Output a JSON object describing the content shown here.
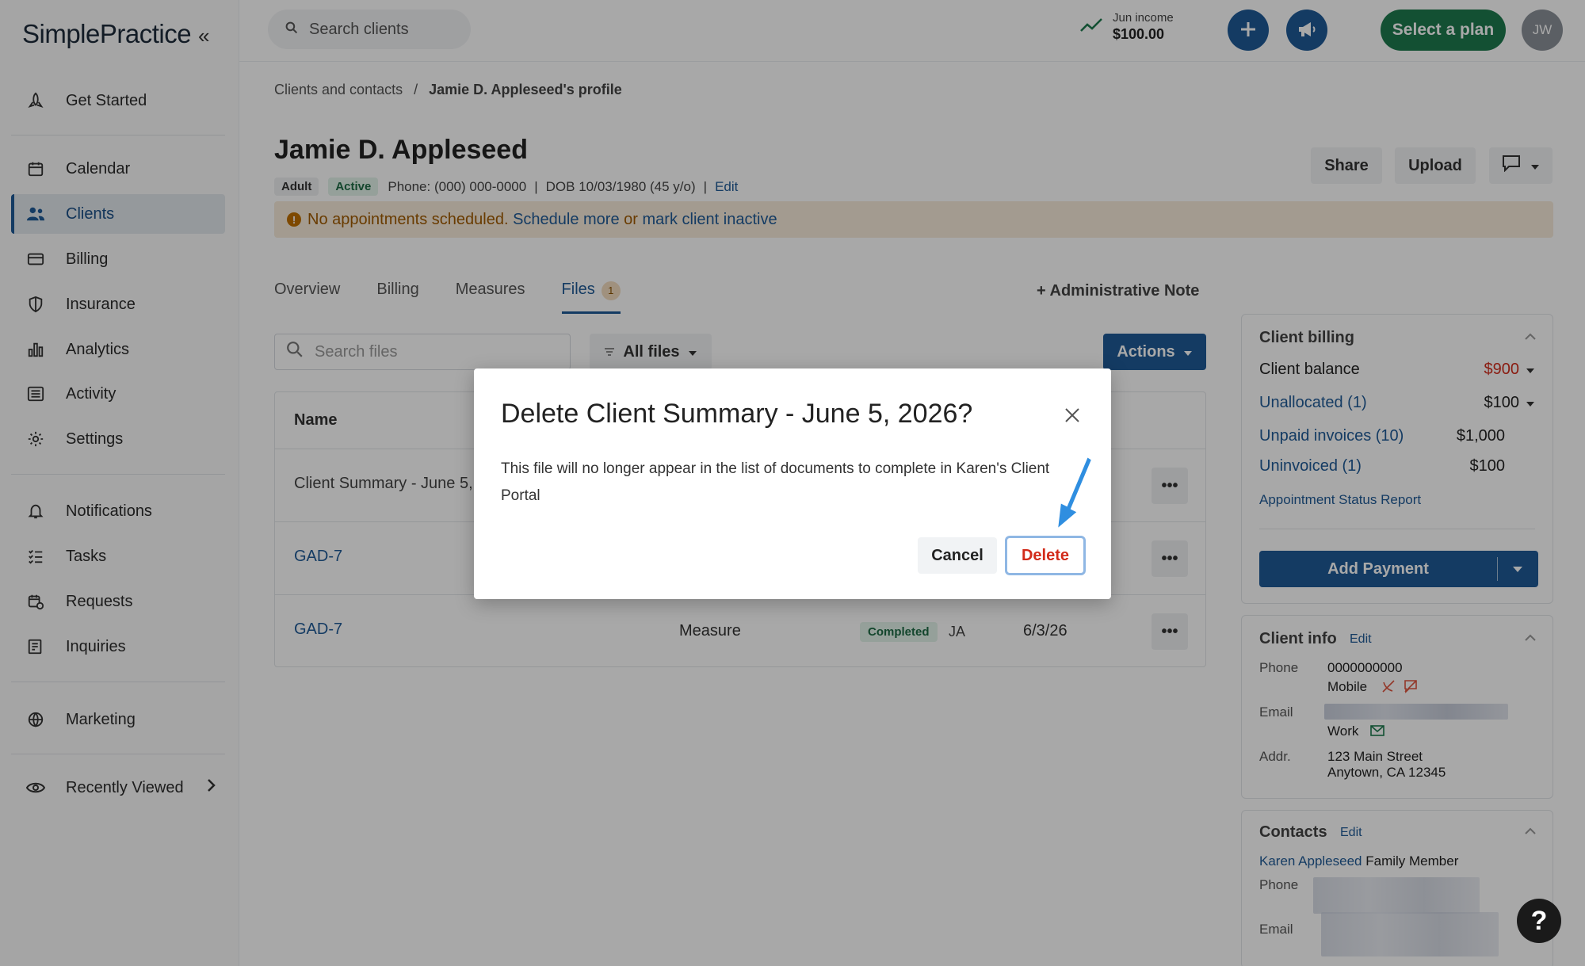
{
  "app": {
    "logo": "SimplePractice",
    "collapse_glyph": "«"
  },
  "sidebar": {
    "items": [
      {
        "label": "Get Started",
        "icon": "rocket-icon"
      },
      {
        "label": "Calendar",
        "icon": "calendar-icon"
      },
      {
        "label": "Clients",
        "icon": "users-icon",
        "active": true
      },
      {
        "label": "Billing",
        "icon": "credit-card-icon"
      },
      {
        "label": "Insurance",
        "icon": "shield-icon"
      },
      {
        "label": "Analytics",
        "icon": "bar-chart-icon"
      },
      {
        "label": "Activity",
        "icon": "list-icon"
      },
      {
        "label": "Settings",
        "icon": "gear-icon"
      },
      {
        "label": "Notifications",
        "icon": "bell-icon"
      },
      {
        "label": "Tasks",
        "icon": "checklist-icon"
      },
      {
        "label": "Requests",
        "icon": "calendar-clock-icon"
      },
      {
        "label": "Inquiries",
        "icon": "inbox-icon"
      },
      {
        "label": "Marketing",
        "icon": "globe-icon"
      },
      {
        "label": "Recently Viewed",
        "icon": "eye-icon"
      }
    ]
  },
  "topbar": {
    "search_placeholder": "Search clients",
    "income_label": "Jun income",
    "income_value": "$100.00",
    "plan_button": "Select a plan",
    "avatar_initials": "JW"
  },
  "breadcrumb": {
    "parent": "Clients and contacts",
    "separator": "/",
    "current": "Jamie D. Appleseed's profile"
  },
  "client": {
    "name": "Jamie D. Appleseed",
    "tag_age": "Adult",
    "tag_status": "Active",
    "phone": "Phone: (000) 000-0000",
    "dob": "DOB 10/03/1980 (45 y/o)",
    "edit": "Edit",
    "pipe": "|"
  },
  "alert": {
    "icon": "!",
    "text": "No appointments scheduled.",
    "link1": "Schedule more",
    "or": "or",
    "link2": "mark client inactive"
  },
  "header_buttons": {
    "share": "Share",
    "upload": "Upload"
  },
  "tabs": [
    {
      "label": "Overview"
    },
    {
      "label": "Billing"
    },
    {
      "label": "Measures"
    },
    {
      "label": "Files",
      "badge": "1",
      "active": true
    }
  ],
  "admin_note": "+ Administrative Note",
  "files": {
    "search_placeholder": "Search files",
    "filter_label": "All files",
    "actions_label": "Actions",
    "column_name": "Name",
    "rows": [
      {
        "name": "Client Summary - June 5,",
        "type": "",
        "status": "",
        "initials": "",
        "date": ""
      },
      {
        "name": "GAD-7",
        "type": "",
        "status": "",
        "initials": "",
        "date": ""
      },
      {
        "name": "GAD-7",
        "type": "Measure",
        "status": "Completed",
        "initials": "JA",
        "date": "6/3/26"
      }
    ],
    "more_glyph": "•••"
  },
  "billing_panel": {
    "title": "Client billing",
    "balance_label": "Client balance",
    "balance_value": "$900",
    "unallocated_label": "Unallocated (1)",
    "unallocated_value": "$100",
    "unpaid_label": "Unpaid invoices (10)",
    "unpaid_value": "$1,000",
    "uninvoiced_label": "Uninvoiced (1)",
    "uninvoiced_value": "$100",
    "report_link": "Appointment Status Report",
    "add_payment": "Add Payment"
  },
  "info_panel": {
    "title": "Client info",
    "edit": "Edit",
    "phone_label": "Phone",
    "phone_value": "0000000000",
    "phone_type": "Mobile",
    "email_label": "Email",
    "email_type": "Work",
    "addr_label": "Addr.",
    "addr_line1": "123 Main Street",
    "addr_line2": "Anytown, CA 12345"
  },
  "contacts_panel": {
    "title": "Contacts",
    "edit": "Edit",
    "contact_name": "Karen Appleseed",
    "contact_relation": "Family Member",
    "phone_label": "Phone",
    "email_label": "Email"
  },
  "modal": {
    "title": "Delete Client Summary - June 5, 2026?",
    "body": "This file will no longer appear in the list of documents to complete in Karen's Client Portal",
    "cancel": "Cancel",
    "delete": "Delete"
  },
  "help_glyph": "?",
  "colors": {
    "primary": "#1f5a96",
    "plan_green": "#1d7a4e",
    "danger": "#d22b1a",
    "alert_bg": "#f8ecdb"
  }
}
